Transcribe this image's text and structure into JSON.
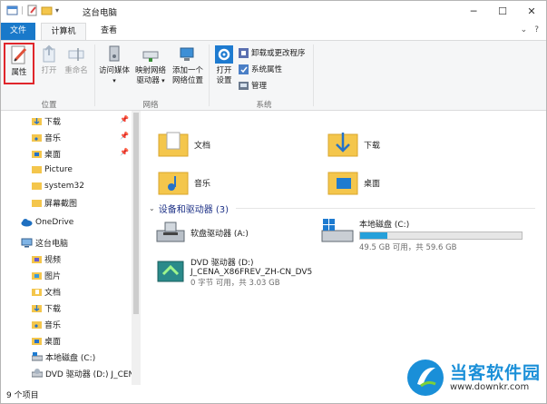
{
  "window": {
    "title": "这台电脑",
    "controls": {
      "minimize": "─",
      "maximize": "☐",
      "close": "✕"
    }
  },
  "tabs": {
    "file": "文件",
    "computer": "计算机",
    "view": "查看",
    "right_icons": {
      "expand": "⌄",
      "help": "?"
    }
  },
  "ribbon": {
    "properties": "属性",
    "open": "打开",
    "rename": "重命名",
    "group_location": "位置",
    "access_media_line1": "访问媒体",
    "map_drive_line1": "映射网络",
    "map_drive_line2": "驱动器",
    "add_location_line1": "添加一个",
    "add_location_line2": "网络位置",
    "group_network": "网络",
    "open_settings_line1": "打开",
    "open_settings_line2": "设置",
    "uninstall": "卸载或更改程序",
    "system_props": "系统属性",
    "manage": "管理",
    "group_system": "系统"
  },
  "nav": {
    "quick": [
      {
        "label": "下载",
        "pinned": true
      },
      {
        "label": "音乐",
        "pinned": true
      },
      {
        "label": "桌面",
        "pinned": true
      },
      {
        "label": "Picture",
        "pinned": false
      },
      {
        "label": "system32",
        "pinned": false
      },
      {
        "label": "屏幕截图",
        "pinned": false
      }
    ],
    "onedrive": "OneDrive",
    "thispc": "这台电脑",
    "pc_children": [
      "视频",
      "图片",
      "文档",
      "下载",
      "音乐",
      "桌面",
      "本地磁盘 (C:)",
      "DVD 驱动器 (D:) J_CEN"
    ]
  },
  "content": {
    "folders": [
      "文档",
      "下载",
      "音乐",
      "桌面"
    ],
    "devices_header": "设备和驱动器 (3)",
    "drives": {
      "floppy": "软盘驱动器 (A:)",
      "local": {
        "name": "本地磁盘 (C:)",
        "free": "49.5 GB 可用，共 59.6 GB",
        "used_fraction": 0.17
      },
      "dvd": {
        "name": "DVD 驱动器 (D:)",
        "label": "J_CENA_X86FREV_ZH-CN_DV5",
        "free": "0 字节 可用，共 3.03 GB"
      }
    }
  },
  "status": {
    "count": "9 个项目"
  },
  "watermark": {
    "brand": "当客软件园",
    "url": "www.downkr.com"
  }
}
